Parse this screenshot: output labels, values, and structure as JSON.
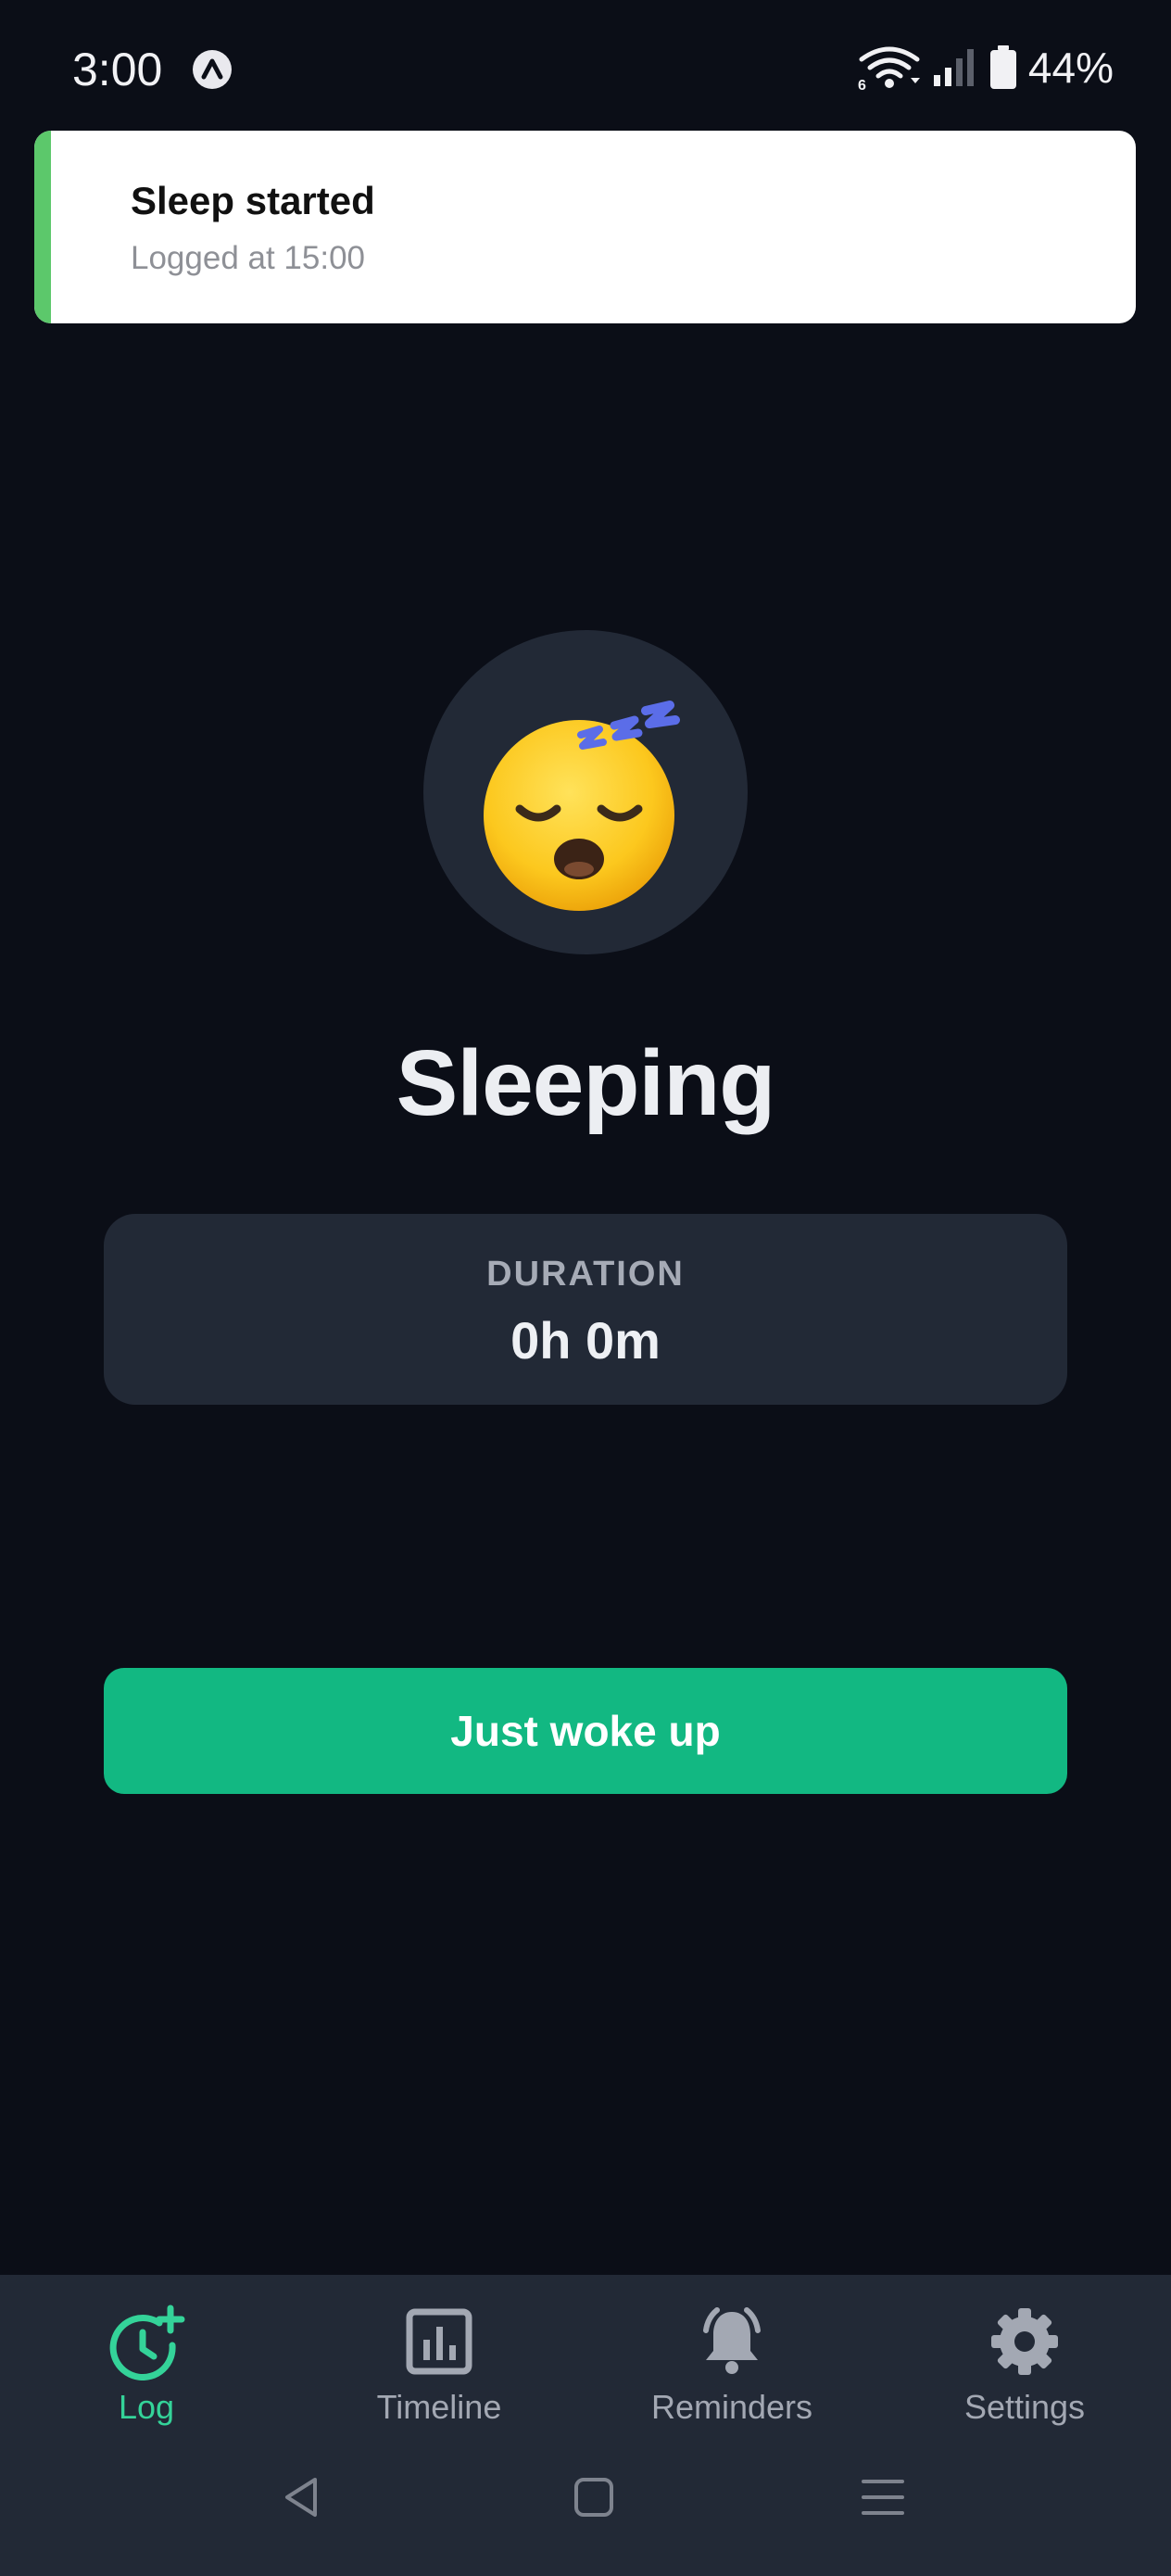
{
  "status_bar": {
    "time": "3:00",
    "app_icon": "app-a-icon",
    "network_label": "6",
    "battery": "44%"
  },
  "toast": {
    "title": "Sleep started",
    "subtitle": "Logged at 15:00",
    "accent_color": "#5cc86b"
  },
  "main": {
    "emoji": "sleeping-face-icon",
    "status": "Sleeping",
    "duration_label": "DURATION",
    "duration_value": "0h 0m",
    "action_button": "Just woke up",
    "action_color": "#12b882"
  },
  "bottom_nav": {
    "items": [
      {
        "label": "Log",
        "icon": "clock-plus-icon",
        "active": true
      },
      {
        "label": "Timeline",
        "icon": "bar-chart-icon",
        "active": false
      },
      {
        "label": "Reminders",
        "icon": "bell-icon",
        "active": false
      },
      {
        "label": "Settings",
        "icon": "gear-icon",
        "active": false
      }
    ],
    "active_color": "#34d399"
  },
  "system_nav": {
    "buttons": [
      "back-icon",
      "home-icon",
      "recents-icon"
    ]
  }
}
